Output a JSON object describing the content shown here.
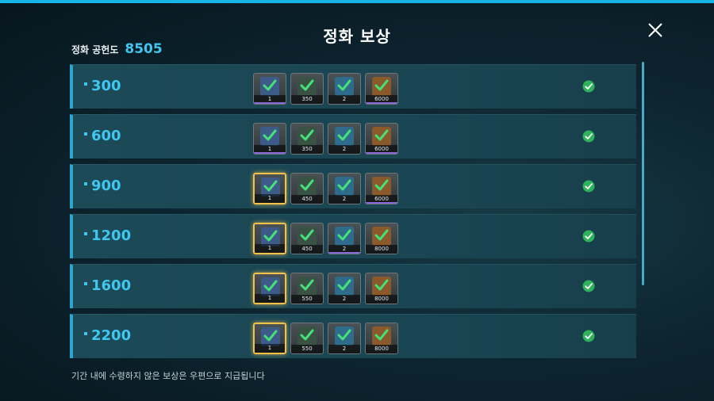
{
  "dialog": {
    "title": "정화 보상",
    "score_label": "정화 공헌도",
    "score_value": "8505",
    "footer_note": "기간 내에 수령하지 않은 보상은 우편으로 지급됩니다"
  },
  "colors": {
    "accent": "#3fc7f0",
    "claimed": "#2fb35a",
    "highlight": "#f2c14b"
  },
  "rows": [
    {
      "tier": "300",
      "items": [
        {
          "icon": "armor-crate-icon",
          "qty": "1"
        },
        {
          "icon": "green-stone-icon",
          "qty": "350"
        },
        {
          "icon": "scroll-icon",
          "qty": "2"
        },
        {
          "icon": "book-icon",
          "qty": "6000"
        }
      ]
    },
    {
      "tier": "600",
      "items": [
        {
          "icon": "armor-crate-icon",
          "qty": "1"
        },
        {
          "icon": "green-stone-icon",
          "qty": "350"
        },
        {
          "icon": "scroll-icon",
          "qty": "2"
        },
        {
          "icon": "book-icon",
          "qty": "6000"
        }
      ]
    },
    {
      "tier": "900",
      "items": [
        {
          "icon": "armor-crate-icon",
          "qty": "1"
        },
        {
          "icon": "green-stone-icon",
          "qty": "450"
        },
        {
          "icon": "scroll-icon",
          "qty": "2"
        },
        {
          "icon": "book-icon",
          "qty": "6000"
        }
      ]
    },
    {
      "tier": "1200",
      "items": [
        {
          "icon": "armor-crate-icon",
          "qty": "1"
        },
        {
          "icon": "green-stone-icon",
          "qty": "450"
        },
        {
          "icon": "scroll-icon",
          "qty": "2"
        },
        {
          "icon": "book-icon",
          "qty": "8000"
        }
      ]
    },
    {
      "tier": "1600",
      "items": [
        {
          "icon": "armor-crate-icon",
          "qty": "1"
        },
        {
          "icon": "green-stone-icon",
          "qty": "550"
        },
        {
          "icon": "scroll-icon",
          "qty": "2"
        },
        {
          "icon": "book-icon",
          "qty": "8000"
        }
      ]
    },
    {
      "tier": "2200",
      "items": [
        {
          "icon": "armor-crate-icon",
          "qty": "1"
        },
        {
          "icon": "green-stone-icon",
          "qty": "550"
        },
        {
          "icon": "scroll-icon",
          "qty": "2"
        },
        {
          "icon": "book-icon",
          "qty": "8000"
        }
      ]
    }
  ]
}
